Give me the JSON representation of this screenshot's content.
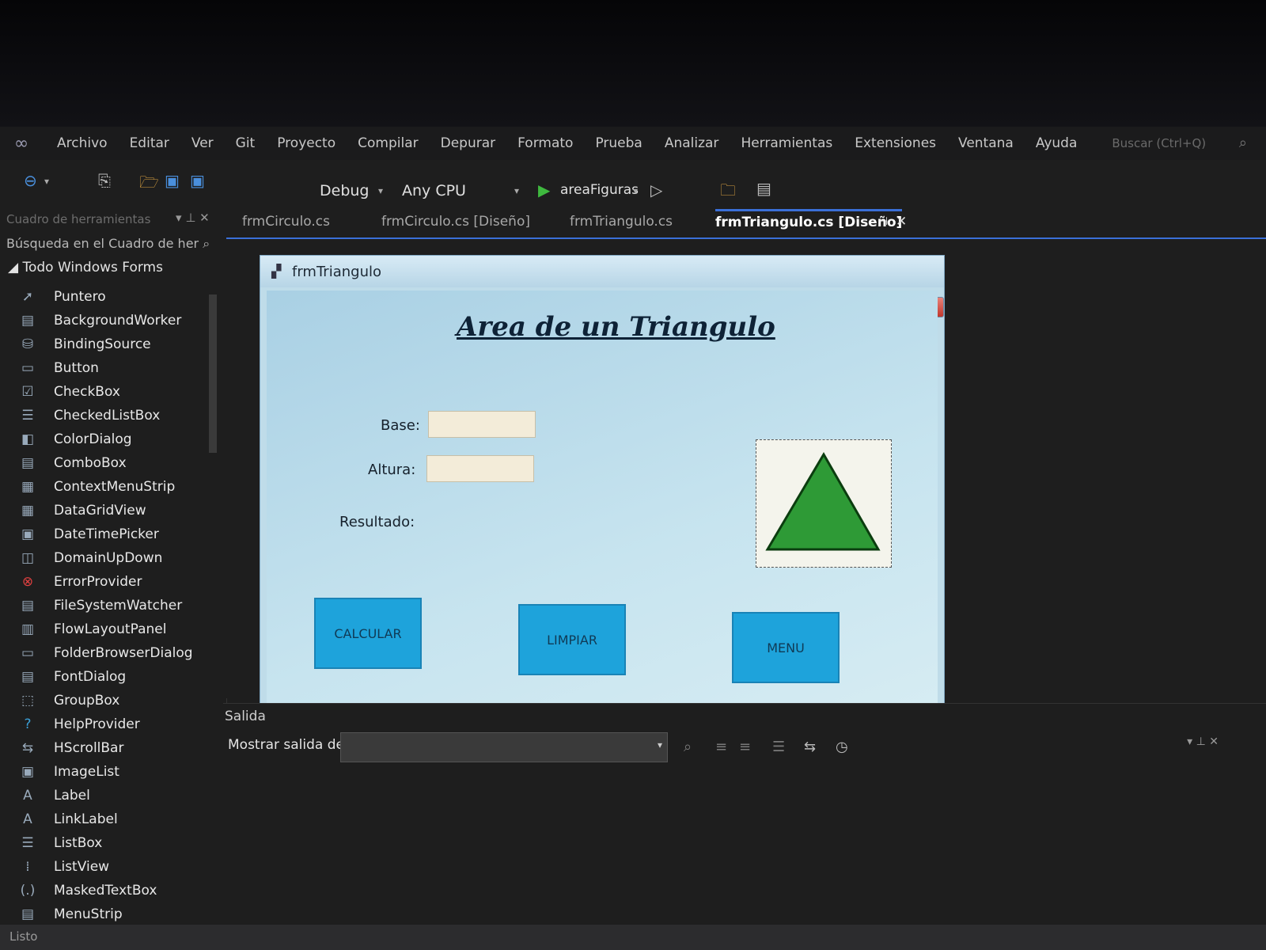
{
  "menubar": {
    "items": [
      "Archivo",
      "Editar",
      "Ver",
      "Git",
      "Proyecto",
      "Compilar",
      "Depurar",
      "Formato",
      "Prueba",
      "Analizar",
      "Herramientas",
      "Extensiones",
      "Ventana",
      "Ayuda"
    ],
    "search": "Buscar (Ctrl+Q)"
  },
  "toolbar": {
    "configuration": "Debug",
    "platform": "Any CPU",
    "startup_project": "areaFiguras"
  },
  "toolbox": {
    "title": "Cuadro de herramientas",
    "search_placeholder": "Búsqueda en el Cuadro de her",
    "group": "Todo Windows Forms",
    "items": [
      {
        "label": "Puntero",
        "icon": "pointer-icon",
        "glyph": "➚"
      },
      {
        "label": "BackgroundWorker",
        "icon": "background-worker-icon",
        "glyph": "▤"
      },
      {
        "label": "BindingSource",
        "icon": "binding-source-icon",
        "glyph": "⛁"
      },
      {
        "label": "Button",
        "icon": "button-icon",
        "glyph": "▭"
      },
      {
        "label": "CheckBox",
        "icon": "checkbox-icon",
        "glyph": "☑"
      },
      {
        "label": "CheckedListBox",
        "icon": "checked-list-icon",
        "glyph": "☰"
      },
      {
        "label": "ColorDialog",
        "icon": "color-dialog-icon",
        "glyph": "◧"
      },
      {
        "label": "ComboBox",
        "icon": "combobox-icon",
        "glyph": "▤"
      },
      {
        "label": "ContextMenuStrip",
        "icon": "context-menu-icon",
        "glyph": "▦"
      },
      {
        "label": "DataGridView",
        "icon": "datagrid-icon",
        "glyph": "▦"
      },
      {
        "label": "DateTimePicker",
        "icon": "datetime-icon",
        "glyph": "▣"
      },
      {
        "label": "DomainUpDown",
        "icon": "domain-updown-icon",
        "glyph": "◫"
      },
      {
        "label": "ErrorProvider",
        "icon": "error-provider-icon",
        "glyph": "⊗"
      },
      {
        "label": "FileSystemWatcher",
        "icon": "file-watcher-icon",
        "glyph": "▤"
      },
      {
        "label": "FlowLayoutPanel",
        "icon": "flow-layout-icon",
        "glyph": "▥"
      },
      {
        "label": "FolderBrowserDialog",
        "icon": "folder-browser-icon",
        "glyph": "▭"
      },
      {
        "label": "FontDialog",
        "icon": "font-dialog-icon",
        "glyph": "▤"
      },
      {
        "label": "GroupBox",
        "icon": "groupbox-icon",
        "glyph": "⬚"
      },
      {
        "label": "HelpProvider",
        "icon": "help-provider-icon",
        "glyph": "?"
      },
      {
        "label": "HScrollBar",
        "icon": "hscrollbar-icon",
        "glyph": "⇆"
      },
      {
        "label": "ImageList",
        "icon": "imagelist-icon",
        "glyph": "▣"
      },
      {
        "label": "Label",
        "icon": "label-icon",
        "glyph": "A"
      },
      {
        "label": "LinkLabel",
        "icon": "linklabel-icon",
        "glyph": "A"
      },
      {
        "label": "ListBox",
        "icon": "listbox-icon",
        "glyph": "☰"
      },
      {
        "label": "ListView",
        "icon": "listview-icon",
        "glyph": "⁞"
      },
      {
        "label": "MaskedTextBox",
        "icon": "masked-textbox-icon",
        "glyph": "(.)"
      },
      {
        "label": "MenuStrip",
        "icon": "menustrip-icon",
        "glyph": "▤"
      }
    ]
  },
  "tabs": [
    {
      "label": "frmCirculo.cs"
    },
    {
      "label": "frmCirculo.cs [Diseño]"
    },
    {
      "label": "frmTriangulo.cs"
    },
    {
      "label": "frmTriangulo.cs [Diseño]"
    }
  ],
  "designer": {
    "window_title": "frmTriangulo",
    "heading": "Area de un Triangulo",
    "base_label": "Base:",
    "altura_label": "Altura:",
    "resultado_label": "Resultado:",
    "calcular_button": "CALCULAR",
    "limpiar_button": "LIMPIAR",
    "menu_button": "MENU",
    "triangle_color": "#2e9a36",
    "button_color": "#1ea3db"
  },
  "output": {
    "title": "Salida",
    "show_output_label": "Mostrar salida de:"
  },
  "status": {
    "text": "Listo"
  }
}
